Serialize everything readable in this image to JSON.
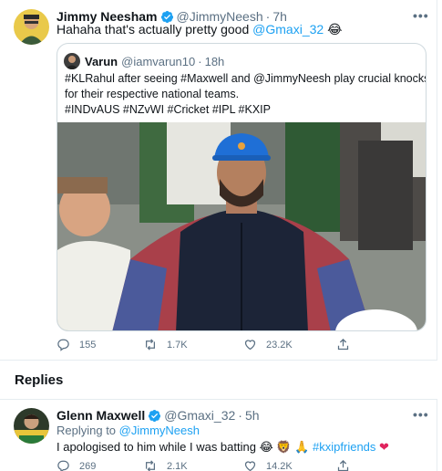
{
  "main_tweet": {
    "name": "Jimmy Neesham",
    "handle": "@JimmyNeesh",
    "time": "7h",
    "text_prefix": "Hahaha that's actually pretty good",
    "mention": "@Gmaxi_32",
    "emoji": "😂",
    "more": "•••",
    "quote": {
      "name": "Varun",
      "handle": "@iamvarun10",
      "time": "18h",
      "line1": "#KLRahul after seeing #Maxwell and @JimmyNeesh play crucial knocks",
      "line2": "for their respective national teams.",
      "line3": "#INDvAUS #NZvWI #Cricket #IPL #KXIP"
    },
    "stats": {
      "replies": "155",
      "retweets": "1.7K",
      "likes": "23.2K"
    }
  },
  "replies_header": "Replies",
  "reply": {
    "name": "Glenn Maxwell",
    "handle": "@Gmaxi_32",
    "time": "5h",
    "replying_label": "Replying to",
    "replying_to": "@JimmyNeesh",
    "text": "I apologised to him while I was batting",
    "emoji1": "😂",
    "emoji2": "🦁",
    "emoji3": "🙏",
    "hashtag": "#kxipfriends",
    "heart": "❤",
    "more": "•••",
    "stats": {
      "replies": "269",
      "retweets": "2.1K",
      "likes": "14.2K"
    }
  },
  "colors": {
    "accent": "#1da1f2",
    "muted": "#5b7083",
    "like": "#e0245e"
  },
  "icons": [
    "verified-icon",
    "reply-icon",
    "retweet-icon",
    "like-icon",
    "share-icon",
    "more-icon"
  ]
}
